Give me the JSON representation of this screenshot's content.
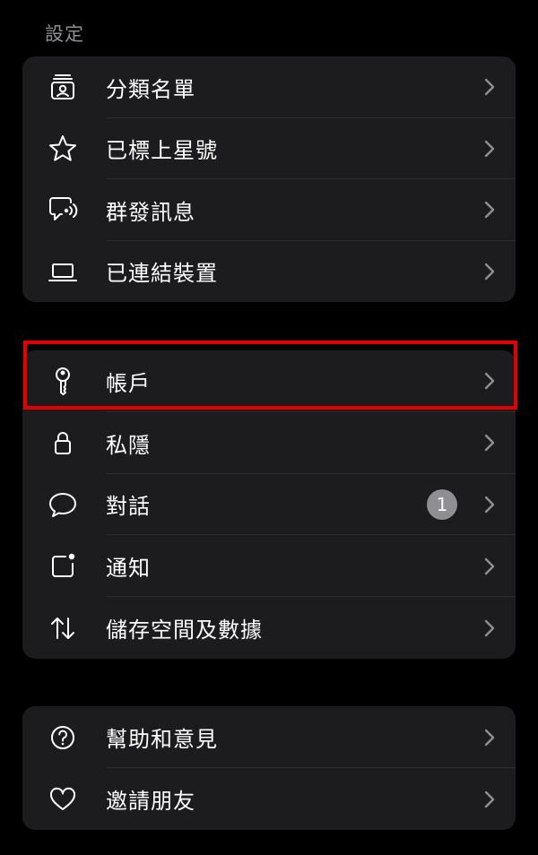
{
  "header": {
    "title": "設定"
  },
  "groups": [
    {
      "items": [
        {
          "label": "分類名單",
          "icon": "contact-list-icon"
        },
        {
          "label": "已標上星號",
          "icon": "star-icon"
        },
        {
          "label": "群發訊息",
          "icon": "broadcast-icon"
        },
        {
          "label": "已連結裝置",
          "icon": "laptop-icon"
        }
      ]
    },
    {
      "items": [
        {
          "label": "帳戶",
          "icon": "key-icon"
        },
        {
          "label": "私隱",
          "icon": "lock-icon"
        },
        {
          "label": "對話",
          "icon": "chat-bubble-icon",
          "badge": "1"
        },
        {
          "label": "通知",
          "icon": "notification-icon"
        },
        {
          "label": "儲存空間及數據",
          "icon": "arrows-updown-icon"
        }
      ]
    },
    {
      "items": [
        {
          "label": "幫助和意見",
          "icon": "help-icon"
        },
        {
          "label": "邀請朋友",
          "icon": "heart-icon"
        }
      ]
    }
  ],
  "colors": {
    "background": "#000000",
    "group_background": "#1c1c1e",
    "text": "#ffffff",
    "secondary_text": "#8e8e93",
    "chevron": "#8e8e93",
    "badge": "#8e8e93",
    "highlight": "#e50000"
  }
}
